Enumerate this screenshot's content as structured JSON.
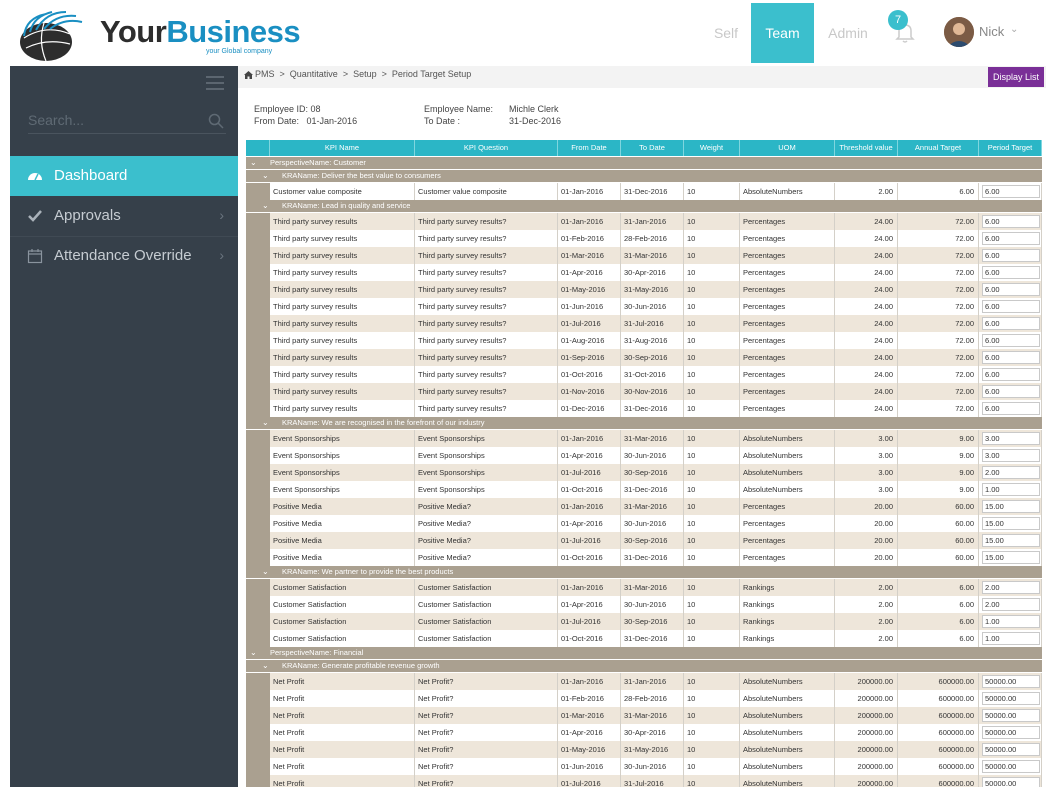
{
  "brand": {
    "name_part1": "Your",
    "name_part2": "Business",
    "tagline": "your Global company"
  },
  "topnav": {
    "self": "Self",
    "team": "Team",
    "admin": "Admin",
    "notifications": "7",
    "user": "Nick"
  },
  "sidebar": {
    "search_placeholder": "Search...",
    "items": [
      {
        "label": "Dashboard",
        "icon": "dashboard-icon",
        "active": true
      },
      {
        "label": "Approvals",
        "icon": "check-icon",
        "active": false
      },
      {
        "label": "Attendance Override",
        "icon": "calendar-icon",
        "active": false
      }
    ]
  },
  "breadcrumb": [
    "PMS",
    "Quantitative",
    "Setup",
    "Period Target Setup"
  ],
  "display_list_label": "Display List",
  "employee": {
    "id_label": "Employee ID:",
    "id": "08",
    "name_label": "Employee Name:",
    "name": "Michle Clerk",
    "from_label": "From Date:",
    "from": "01-Jan-2016",
    "to_label": "To Date :",
    "to": "31-Dec-2016"
  },
  "columns": [
    "KPI Name",
    "KPI Question",
    "From Date",
    "To Date",
    "Weight",
    "UOM",
    "Threshold value",
    "Annual Target",
    "Period Target"
  ],
  "groups": [
    {
      "perspective": "PerspectiveName: Customer",
      "kra": "KRAName: Deliver the best value to consumers",
      "rows": [
        [
          "Customer value composite",
          "Customer value composite",
          "01-Jan-2016",
          "31-Dec-2016",
          "10",
          "AbsoluteNumbers",
          "2.00",
          "6.00",
          "6.00"
        ]
      ]
    },
    {
      "kra": "KRAName: Lead in quality and service",
      "rows": [
        [
          "Third party survey results",
          "Third party survey results?",
          "01-Jan-2016",
          "31-Jan-2016",
          "10",
          "Percentages",
          "24.00",
          "72.00",
          "6.00"
        ],
        [
          "Third party survey results",
          "Third party survey results?",
          "01-Feb-2016",
          "28-Feb-2016",
          "10",
          "Percentages",
          "24.00",
          "72.00",
          "6.00"
        ],
        [
          "Third party survey results",
          "Third party survey results?",
          "01-Mar-2016",
          "31-Mar-2016",
          "10",
          "Percentages",
          "24.00",
          "72.00",
          "6.00"
        ],
        [
          "Third party survey results",
          "Third party survey results?",
          "01-Apr-2016",
          "30-Apr-2016",
          "10",
          "Percentages",
          "24.00",
          "72.00",
          "6.00"
        ],
        [
          "Third party survey results",
          "Third party survey results?",
          "01-May-2016",
          "31-May-2016",
          "10",
          "Percentages",
          "24.00",
          "72.00",
          "6.00"
        ],
        [
          "Third party survey results",
          "Third party survey results?",
          "01-Jun-2016",
          "30-Jun-2016",
          "10",
          "Percentages",
          "24.00",
          "72.00",
          "6.00"
        ],
        [
          "Third party survey results",
          "Third party survey results?",
          "01-Jul-2016",
          "31-Jul-2016",
          "10",
          "Percentages",
          "24.00",
          "72.00",
          "6.00"
        ],
        [
          "Third party survey results",
          "Third party survey results?",
          "01-Aug-2016",
          "31-Aug-2016",
          "10",
          "Percentages",
          "24.00",
          "72.00",
          "6.00"
        ],
        [
          "Third party survey results",
          "Third party survey results?",
          "01-Sep-2016",
          "30-Sep-2016",
          "10",
          "Percentages",
          "24.00",
          "72.00",
          "6.00"
        ],
        [
          "Third party survey results",
          "Third party survey results?",
          "01-Oct-2016",
          "31-Oct-2016",
          "10",
          "Percentages",
          "24.00",
          "72.00",
          "6.00"
        ],
        [
          "Third party survey results",
          "Third party survey results?",
          "01-Nov-2016",
          "30-Nov-2016",
          "10",
          "Percentages",
          "24.00",
          "72.00",
          "6.00"
        ],
        [
          "Third party survey results",
          "Third party survey results?",
          "01-Dec-2016",
          "31-Dec-2016",
          "10",
          "Percentages",
          "24.00",
          "72.00",
          "6.00"
        ]
      ]
    },
    {
      "kra": "KRAName: We are recognised in the forefront of our industry",
      "rows": [
        [
          "Event Sponsorships",
          "Event Sponsorships",
          "01-Jan-2016",
          "31-Mar-2016",
          "10",
          "AbsoluteNumbers",
          "3.00",
          "9.00",
          "3.00"
        ],
        [
          "Event Sponsorships",
          "Event Sponsorships",
          "01-Apr-2016",
          "30-Jun-2016",
          "10",
          "AbsoluteNumbers",
          "3.00",
          "9.00",
          "3.00"
        ],
        [
          "Event Sponsorships",
          "Event Sponsorships",
          "01-Jul-2016",
          "30-Sep-2016",
          "10",
          "AbsoluteNumbers",
          "3.00",
          "9.00",
          "2.00"
        ],
        [
          "Event Sponsorships",
          "Event Sponsorships",
          "01-Oct-2016",
          "31-Dec-2016",
          "10",
          "AbsoluteNumbers",
          "3.00",
          "9.00",
          "1.00"
        ],
        [
          "Positive Media",
          "Positive Media?",
          "01-Jan-2016",
          "31-Mar-2016",
          "10",
          "Percentages",
          "20.00",
          "60.00",
          "15.00"
        ],
        [
          "Positive Media",
          "Positive Media?",
          "01-Apr-2016",
          "30-Jun-2016",
          "10",
          "Percentages",
          "20.00",
          "60.00",
          "15.00"
        ],
        [
          "Positive Media",
          "Positive Media?",
          "01-Jul-2016",
          "30-Sep-2016",
          "10",
          "Percentages",
          "20.00",
          "60.00",
          "15.00"
        ],
        [
          "Positive Media",
          "Positive Media?",
          "01-Oct-2016",
          "31-Dec-2016",
          "10",
          "Percentages",
          "20.00",
          "60.00",
          "15.00"
        ]
      ]
    },
    {
      "kra": "KRAName: We partner to provide the best products",
      "rows": [
        [
          "Customer Satisfaction",
          "Customer Satisfaction",
          "01-Jan-2016",
          "31-Mar-2016",
          "10",
          "Rankings",
          "2.00",
          "6.00",
          "2.00"
        ],
        [
          "Customer Satisfaction",
          "Customer Satisfaction",
          "01-Apr-2016",
          "30-Jun-2016",
          "10",
          "Rankings",
          "2.00",
          "6.00",
          "2.00"
        ],
        [
          "Customer Satisfaction",
          "Customer Satisfaction",
          "01-Jul-2016",
          "30-Sep-2016",
          "10",
          "Rankings",
          "2.00",
          "6.00",
          "1.00"
        ],
        [
          "Customer Satisfaction",
          "Customer Satisfaction",
          "01-Oct-2016",
          "31-Dec-2016",
          "10",
          "Rankings",
          "2.00",
          "6.00",
          "1.00"
        ]
      ]
    },
    {
      "perspective": "PerspectiveName: Financial",
      "kra": "KRAName: Generate profitable revenue growth",
      "rows": [
        [
          "Net Profit",
          "Net Profit?",
          "01-Jan-2016",
          "31-Jan-2016",
          "10",
          "AbsoluteNumbers",
          "200000.00",
          "600000.00",
          "50000.00"
        ],
        [
          "Net Profit",
          "Net Profit?",
          "01-Feb-2016",
          "28-Feb-2016",
          "10",
          "AbsoluteNumbers",
          "200000.00",
          "600000.00",
          "50000.00"
        ],
        [
          "Net Profit",
          "Net Profit?",
          "01-Mar-2016",
          "31-Mar-2016",
          "10",
          "AbsoluteNumbers",
          "200000.00",
          "600000.00",
          "50000.00"
        ],
        [
          "Net Profit",
          "Net Profit?",
          "01-Apr-2016",
          "30-Apr-2016",
          "10",
          "AbsoluteNumbers",
          "200000.00",
          "600000.00",
          "50000.00"
        ],
        [
          "Net Profit",
          "Net Profit?",
          "01-May-2016",
          "31-May-2016",
          "10",
          "AbsoluteNumbers",
          "200000.00",
          "600000.00",
          "50000.00"
        ],
        [
          "Net Profit",
          "Net Profit?",
          "01-Jun-2016",
          "30-Jun-2016",
          "10",
          "AbsoluteNumbers",
          "200000.00",
          "600000.00",
          "50000.00"
        ],
        [
          "Net Profit",
          "Net Profit?",
          "01-Jul-2016",
          "31-Jul-2016",
          "10",
          "AbsoluteNumbers",
          "200000.00",
          "600000.00",
          "50000.00"
        ]
      ]
    }
  ]
}
